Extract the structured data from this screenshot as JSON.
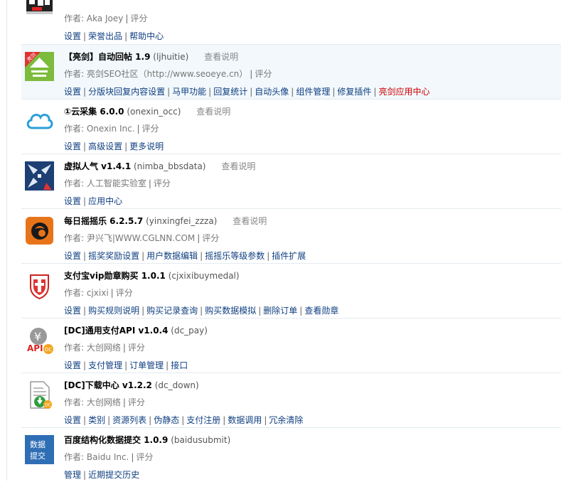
{
  "labels": {
    "author_prefix": "作者: ",
    "rate": "评分",
    "explain": "查看说明"
  },
  "plugins": [
    {
      "id": "aka",
      "author": "Aka Joey",
      "links": [
        "设置",
        "荣誉出品",
        "帮助中心"
      ]
    },
    {
      "id": "ljhuitie",
      "name": "【亮剑】自动回帖 1.9",
      "ident": "(ljhuitie)",
      "author": "亮剑SEO社区（http://www.seoeye.cn）",
      "links": [
        "设置",
        "分版块回复内容设置",
        "马甲功能",
        "回复统计",
        "自动头像",
        "组件管理",
        "修复插件",
        "亮剑应用中心"
      ]
    },
    {
      "id": "onexin",
      "name": "①云采集 6.0.0",
      "ident": "(onexin_occ)",
      "author": "Onexin Inc.",
      "links": [
        "设置",
        "高级设置",
        "更多说明"
      ]
    },
    {
      "id": "nimba",
      "name": "虚拟人气 v1.4.1",
      "ident": "(nimba_bbsdata)",
      "author": "人工智能实验室",
      "links": [
        "设置",
        "应用中心"
      ]
    },
    {
      "id": "zzza",
      "name": "每日摇摇乐 6.2.5.7",
      "ident": "(yinxingfei_zzza)",
      "author": "尹兴飞|WWW.CGLNN.COM",
      "links": [
        "设置",
        "摇奖奖励设置",
        "用户数据编辑",
        "摇摇乐等级参数",
        "插件扩展"
      ]
    },
    {
      "id": "cjxixi",
      "name": "支付宝vip勋章购买 1.0.1",
      "ident": "(cjxixibuymedal)",
      "author": "cjxixi",
      "links": [
        "设置",
        "购买规则说明",
        "购买记录查询",
        "购买数据模拟",
        "删除订单",
        "查看勋章"
      ]
    },
    {
      "id": "dcpay",
      "name": "[DC]通用支付API v1.0.4",
      "ident": "(dc_pay)",
      "author": "大创网络",
      "links": [
        "设置",
        "支付管理",
        "订单管理",
        "接口"
      ]
    },
    {
      "id": "dcdown",
      "name": "[DC]下载中心 v1.2.2",
      "ident": "(dc_down)",
      "author": "大创网络",
      "links": [
        "设置",
        "类别",
        "资源列表",
        "伪静态",
        "支付注册",
        "数据调用",
        "冗余清除"
      ]
    },
    {
      "id": "baidu",
      "name": "百度结构化数据提交 1.0.9",
      "ident": "(baidusubmit)",
      "author": "Baidu Inc.",
      "links": [
        "管理",
        "近期提交历史"
      ]
    }
  ],
  "icons": {
    "ljhuitie": {
      "badge": "亮剑"
    },
    "dcpay": {
      "symbol": "¥",
      "word": "API",
      "tag": "DC"
    },
    "dcdown": {
      "tag": "DC"
    },
    "baidu": {
      "line1": "数据",
      "line2": "提交"
    }
  },
  "colors": {
    "link": "#0f3f80",
    "app_center_link": "#c00000",
    "hover_row": "#f2f8fc"
  }
}
